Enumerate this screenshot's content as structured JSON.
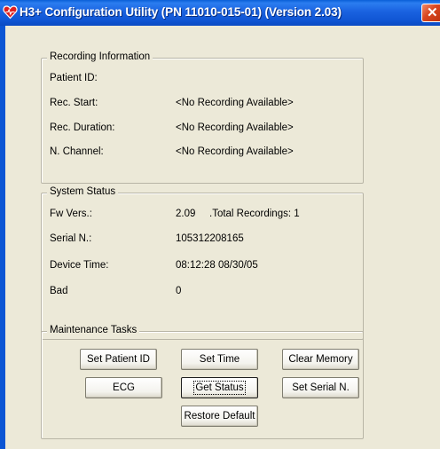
{
  "window": {
    "title": "H3+ Configuration Utility (PN 11010-015-01) (Version 2.03)",
    "close_glyph": "✕"
  },
  "recording": {
    "legend": "Recording Information",
    "patient_id_label": "Patient ID:",
    "patient_id_value": "",
    "rec_start_label": "Rec. Start:",
    "rec_start_value": "<No Recording Available>",
    "rec_duration_label": "Rec. Duration:",
    "rec_duration_value": "<No Recording Available>",
    "n_channel_label": "N. Channel:",
    "n_channel_value": "<No Recording Available>"
  },
  "status": {
    "legend": "System Status",
    "fw_label": "Fw Vers.:",
    "fw_value": "2.09",
    "total_recordings": ".Total Recordings: 1",
    "serial_label": "Serial N.:",
    "serial_value": "105312208165",
    "device_time_label": "Device Time:",
    "device_time_value": "08:12:28 08/30/05",
    "bad_label": "Bad",
    "bad_value": "0"
  },
  "maintenance": {
    "legend": "Maintenance Tasks",
    "set_patient_id": "Set Patient ID",
    "set_time": "Set Time",
    "clear_memory": "Clear Memory",
    "ecg": "ECG",
    "get_status": "Get Status",
    "set_serial": "Set Serial N.",
    "restore_default": "Restore Default"
  },
  "icons": {
    "app": "heart-icon",
    "close": "close-icon"
  },
  "colors": {
    "titlebar": "#0b55d4",
    "close": "#d9461f",
    "background": "#ece9d8"
  }
}
